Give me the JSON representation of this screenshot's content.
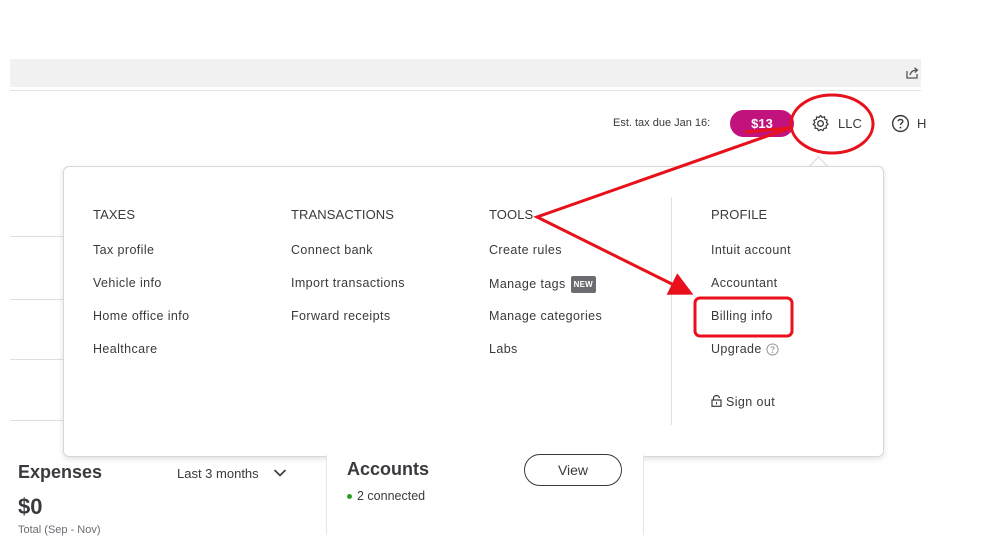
{
  "header": {
    "est_tax_label": "Est. tax due Jan 16:",
    "tax_amount": "$13",
    "company_label": "LLC",
    "help_partial": "H",
    "icons": {
      "settings": "gear-icon",
      "help": "help-circle-icon",
      "share": "share-icon"
    }
  },
  "menu": {
    "taxes": {
      "heading": "TAXES",
      "items": [
        "Tax profile",
        "Vehicle info",
        "Home office info",
        "Healthcare"
      ]
    },
    "transactions": {
      "heading": "TRANSACTIONS",
      "items": [
        "Connect bank",
        "Import transactions",
        "Forward receipts"
      ]
    },
    "tools": {
      "heading": "TOOLS",
      "items": [
        "Create rules",
        "Manage tags",
        "Manage categories",
        "Labs"
      ],
      "new_badge": "NEW"
    },
    "profile": {
      "heading": "PROFILE",
      "items": [
        "Intuit account",
        "Accountant",
        "Billing info",
        "Upgrade"
      ],
      "sign_out": "Sign out"
    }
  },
  "expenses": {
    "title": "Expenses",
    "range": "Last 3 months",
    "value": "$0",
    "subtitle": "Total (Sep - Nov)"
  },
  "accounts": {
    "title": "Accounts",
    "status": "2 connected",
    "view_button": "View"
  },
  "colors": {
    "tax_pill": "#c1127e",
    "annotation": "#e8101a",
    "connected_dot": "#2ca01c"
  }
}
